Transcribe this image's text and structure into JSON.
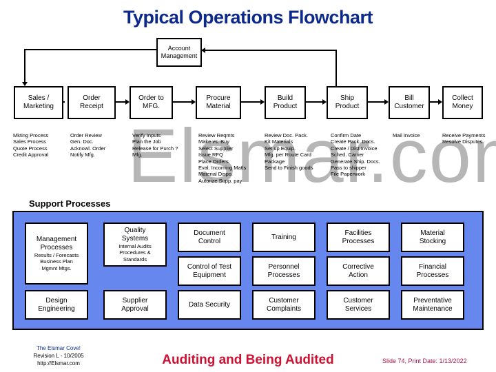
{
  "title": "Typical Operations Flowchart",
  "watermark": "Elsmar.com",
  "account_management": "Account\nManagement",
  "process_steps": [
    {
      "label": "Sales /\nMarketing",
      "tasks": [
        "Mkting Process",
        "Sales Process",
        "Quote Process",
        "Credit Approval"
      ]
    },
    {
      "label": "Order\nReceipt",
      "tasks": [
        "Order Review",
        "Gen. Doc.",
        "Acknowl. Order",
        "Notify Mfg."
      ]
    },
    {
      "label": "Order to\nMFG.",
      "tasks": [
        "Verify Inputs",
        "Plan the Job",
        "Release for Purch ?",
        "Mfg."
      ]
    },
    {
      "label": "Procure\nMaterial",
      "tasks": [
        "Review Reqmts",
        "Make vs. Buy",
        "Select Supplier",
        "Issue RFQ",
        "Place Orders",
        "Eval. Incoming Matls",
        "Material Dispo.",
        "Autorize Supp. pay"
      ]
    },
    {
      "label": "Build\nProduct",
      "tasks": [
        "Review Doc. Pack.",
        "Kit Materials",
        "Set up Equip.",
        "Mfg. per Route Card",
        "Package",
        "Send to Finish goods"
      ]
    },
    {
      "label": "Ship\nProduct",
      "tasks": [
        "Confirm Date",
        "Create Pack. Docs.",
        "Create / Dist Invoice",
        "Sched. Carrier",
        "Generate Ship. Docs.",
        "Pass to shipper",
        "File Paperwork"
      ]
    },
    {
      "label": "Bill\nCustomer",
      "tasks": [
        "Mail Invoice"
      ]
    },
    {
      "label": "Collect\nMoney",
      "tasks": [
        "Receive Payments",
        "Resolve Disputes"
      ]
    }
  ],
  "support": {
    "heading": "Support Processes",
    "management": {
      "label": "Management\nProcesses",
      "sub": "Results / Forecasts\nBusiness Plan\nMgmnt Mtgs."
    },
    "quality": {
      "label": "Quality\nSystems",
      "sub": "Internal Audits\nProcedures &\nStandards"
    },
    "design_engineering": "Design\nEngineering",
    "supplier_approval": "Supplier\nApproval",
    "document_control": "Document\nControl",
    "control_test_equipment": "Control of Test\nEquipment",
    "data_security": "Data Security",
    "training": "Training",
    "personnel_processes": "Personnel\nProcesses",
    "customer_complaints": "Customer\nComplaints",
    "facilities_processes": "Facilities\nProcesses",
    "corrective_action": "Corrective\nAction",
    "customer_services": "Customer\nServices",
    "material_stocking": "Material\nStocking",
    "financial_processes": "Financial\nProcesses",
    "preventative_maintenance": "Preventative\nMaintenance"
  },
  "footer": {
    "cove": "The Elsmar Cove!",
    "revision": "Revision L - 10/2005",
    "url": "http://Elsmar.com",
    "center": "Auditing and Being Audited",
    "slide": "Slide 74,  Print Date: 1/13/2022"
  },
  "colors": {
    "title": "#0d2a8a",
    "support_bg": "#6688ee",
    "footer_center": "#cc1133",
    "footer_right": "#aa1144"
  }
}
